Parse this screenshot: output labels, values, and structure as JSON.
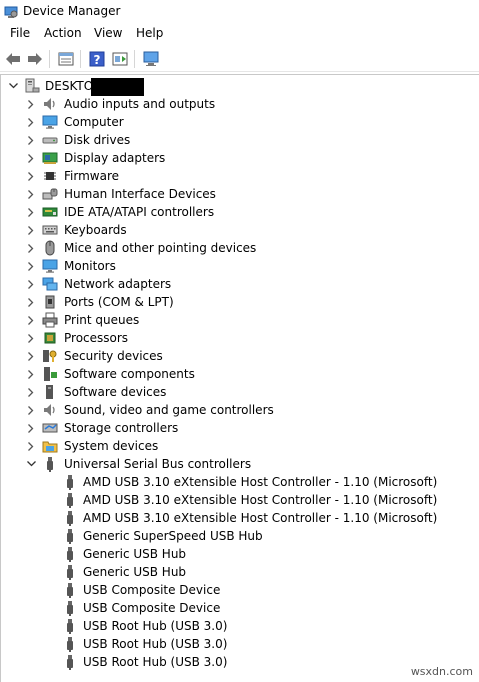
{
  "window": {
    "title": "Device Manager"
  },
  "menu": [
    "File",
    "Action",
    "View",
    "Help"
  ],
  "toolbar_icons": [
    "back-icon",
    "forward-icon",
    "properties-icon",
    "help-icon",
    "update-driver-icon",
    "scan-hardware-icon"
  ],
  "tree": {
    "root_label": "DESKTOP",
    "categories": [
      {
        "label": "Audio inputs and outputs",
        "icon": "speaker-icon"
      },
      {
        "label": "Computer",
        "icon": "monitor-icon"
      },
      {
        "label": "Disk drives",
        "icon": "disk-icon"
      },
      {
        "label": "Display adapters",
        "icon": "display-adapter-icon"
      },
      {
        "label": "Firmware",
        "icon": "chip-icon"
      },
      {
        "label": "Human Interface Devices",
        "icon": "hid-icon"
      },
      {
        "label": "IDE ATA/ATAPI controllers",
        "icon": "ide-icon"
      },
      {
        "label": "Keyboards",
        "icon": "keyboard-icon"
      },
      {
        "label": "Mice and other pointing devices",
        "icon": "mouse-icon"
      },
      {
        "label": "Monitors",
        "icon": "monitor-icon"
      },
      {
        "label": "Network adapters",
        "icon": "network-icon"
      },
      {
        "label": "Ports (COM & LPT)",
        "icon": "port-icon"
      },
      {
        "label": "Print queues",
        "icon": "printer-icon"
      },
      {
        "label": "Processors",
        "icon": "cpu-icon"
      },
      {
        "label": "Security devices",
        "icon": "security-icon"
      },
      {
        "label": "Software components",
        "icon": "software-component-icon"
      },
      {
        "label": "Software devices",
        "icon": "software-device-icon"
      },
      {
        "label": "Sound, video and game controllers",
        "icon": "speaker-icon"
      },
      {
        "label": "Storage controllers",
        "icon": "storage-icon"
      },
      {
        "label": "System devices",
        "icon": "system-folder-icon"
      },
      {
        "label": "Universal Serial Bus controllers",
        "icon": "usb-icon"
      }
    ],
    "usb_children": [
      "AMD USB 3.10 eXtensible Host Controller - 1.10 (Microsoft)",
      "AMD USB 3.10 eXtensible Host Controller - 1.10 (Microsoft)",
      "AMD USB 3.10 eXtensible Host Controller - 1.10 (Microsoft)",
      "Generic SuperSpeed USB Hub",
      "Generic USB Hub",
      "Generic USB Hub",
      "USB Composite Device",
      "USB Composite Device",
      "USB Root Hub (USB 3.0)",
      "USB Root Hub (USB 3.0)",
      "USB Root Hub (USB 3.0)"
    ]
  },
  "watermark": "wsxdn.com"
}
